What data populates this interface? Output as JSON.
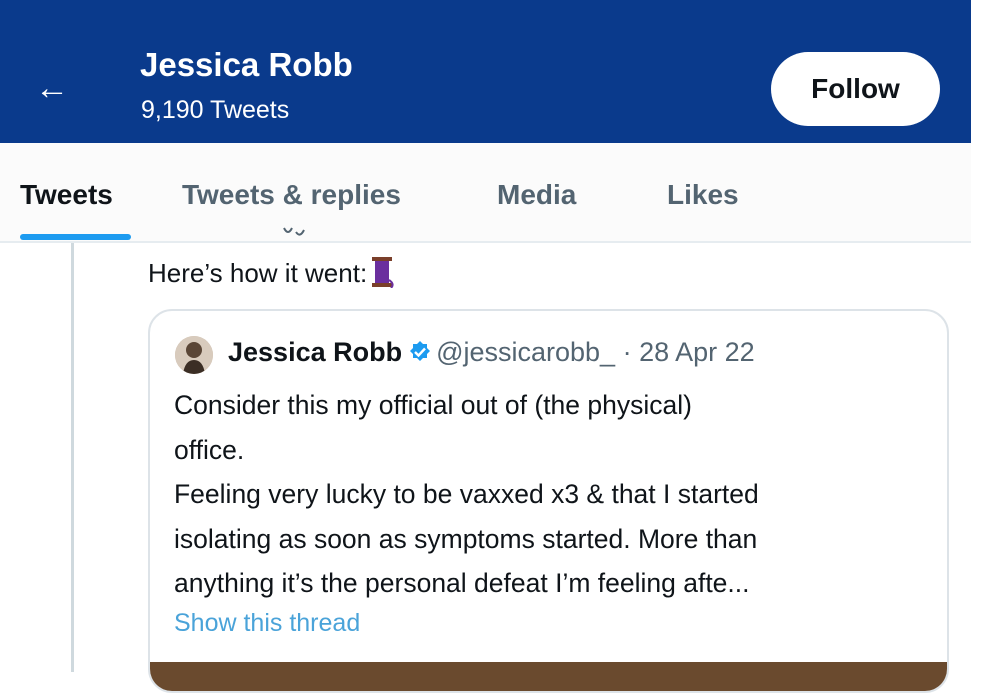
{
  "header": {
    "back_icon": "arrow-left-icon",
    "name": "Jessica Robb",
    "tweet_count": "9,190 Tweets",
    "follow_label": "Follow",
    "bg_color": "#0a3a8c"
  },
  "tabs": [
    {
      "label": "Tweets",
      "active": true
    },
    {
      "label": "Tweets & replies",
      "active": false
    },
    {
      "label": "Media",
      "active": false
    },
    {
      "label": "Likes",
      "active": false
    }
  ],
  "tweet": {
    "text": "Here’s how it went:",
    "emoji_icon": "thread-spool-icon"
  },
  "quote": {
    "name": "Jessica Robb",
    "verified_icon": "verified-badge-icon",
    "handle_date": "@jessicarobb_ · 28 Apr 22",
    "body_lines": [
      "Consider this my official out of (the physical)",
      "office.",
      "Feeling very lucky to be vaxxed x3 & that I started",
      "isolating as soon as symptoms started. More than",
      "anything it’s the personal defeat I’m feeling afte..."
    ],
    "show_thread": "Show this thread"
  },
  "colors": {
    "accent": "#1d9bf0",
    "link": "#4aa3d9"
  }
}
